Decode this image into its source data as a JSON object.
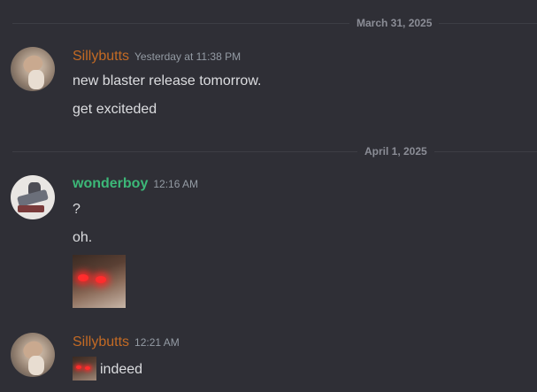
{
  "dividers": [
    {
      "date": "March 31, 2025"
    },
    {
      "date": "April 1, 2025"
    }
  ],
  "messages": [
    {
      "username": "Sillybutts",
      "timestamp": "Yesterday at 11:38 PM",
      "lines": [
        "new blaster release tomorrow.",
        "get exciteded"
      ]
    },
    {
      "username": "wonderboy",
      "timestamp": "12:16 AM",
      "lines": [
        "?",
        "oh."
      ]
    },
    {
      "username": "Sillybutts",
      "timestamp": "12:21 AM",
      "lines": [
        "indeed"
      ]
    }
  ],
  "colors": {
    "background": "#2f2f36",
    "sillybutts_name": "#c36a24",
    "wonderboy_name": "#3cb878",
    "text": "#dcdde0",
    "timestamp": "#949ba4",
    "divider_date": "#8b8d96"
  },
  "icons": {
    "image_attachment": "glowing-red-eyes-image",
    "inline_emoji": "glowing-red-eyes-emoji"
  }
}
